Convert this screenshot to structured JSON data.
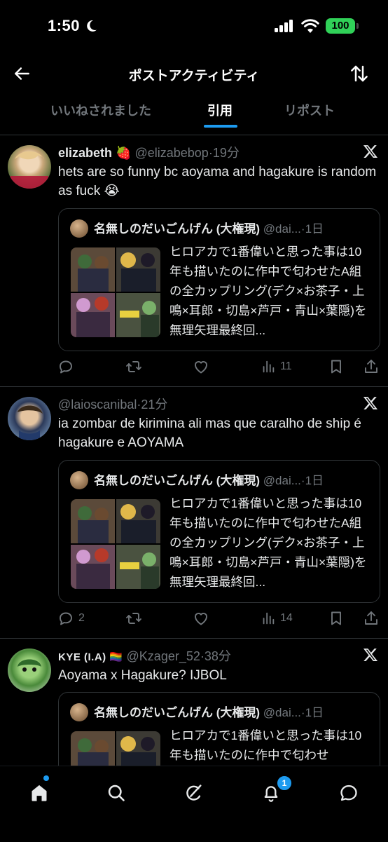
{
  "status_bar": {
    "time": "1:50",
    "battery": "100"
  },
  "header": {
    "title": "ポストアクティビティ"
  },
  "tabs": [
    {
      "label": "いいねされました",
      "active": false
    },
    {
      "label": "引用",
      "active": true
    },
    {
      "label": "リポスト",
      "active": false
    }
  ],
  "posts": [
    {
      "name": "elizabeth 🍓",
      "handle": "@elizabebop",
      "dot": "·",
      "time": "19分",
      "text": "hets are so funny bc aoyama and hagakure is random as fuck 😭",
      "quote": {
        "name": "名無しのだいごんげん (大権現)",
        "handle": "@dai...",
        "dot": "·",
        "time": "1日",
        "text": "ヒロアカで1番偉いと思った事は10年も描いたのに作中で匂わせたA組の全カップリング(デク×お茶子・上鳴×耳郎・切島×芦戸・青山×葉隠)を無理矢理最終回..."
      },
      "stats": {
        "replies": "",
        "reposts": "",
        "likes": "",
        "views": "11"
      }
    },
    {
      "name": "",
      "handle": "@laioscanibal",
      "dot": "·",
      "time": "21分",
      "text": "ia zombar de kirimina ali mas que caralho de ship é hagakure e AOYAMA",
      "quote": {
        "name": "名無しのだいごんげん (大権現)",
        "handle": "@dai...",
        "dot": "·",
        "time": "1日",
        "text": "ヒロアカで1番偉いと思った事は10年も描いたのに作中で匂わせたA組の全カップリング(デク×お茶子・上鳴×耳郎・切島×芦戸・青山×葉隠)を無理矢理最終回..."
      },
      "stats": {
        "replies": "2",
        "reposts": "",
        "likes": "",
        "views": "14"
      }
    },
    {
      "name": "KYE (I.A) 🏳️‍🌈",
      "handle": "@Kzager_52",
      "dot": "·",
      "time": "38分",
      "text": "Aoyama x Hagakure? IJBOL",
      "quote": {
        "name": "名無しのだいごんげん (大権現)",
        "handle": "@dai...",
        "dot": "·",
        "time": "1日",
        "text": "ヒロアカで1番偉いと思った事は10年も描いたのに作中で匂わせ"
      }
    }
  ],
  "bottom_nav": {
    "notification_count": "1"
  },
  "icons": [
    "back-arrow-icon",
    "sort-icon",
    "x-logo-icon",
    "reply-icon",
    "repost-icon",
    "like-icon",
    "views-icon",
    "bookmark-icon",
    "share-icon",
    "home-icon",
    "search-icon",
    "grok-icon",
    "bell-icon",
    "messages-icon",
    "moon-icon",
    "signal-icon",
    "wifi-icon"
  ],
  "colors": {
    "accent": "#1d9bf0",
    "background": "#000000",
    "muted": "#71767b",
    "text": "#e7e9ea",
    "divider": "#2f3336",
    "battery": "#30d158"
  }
}
